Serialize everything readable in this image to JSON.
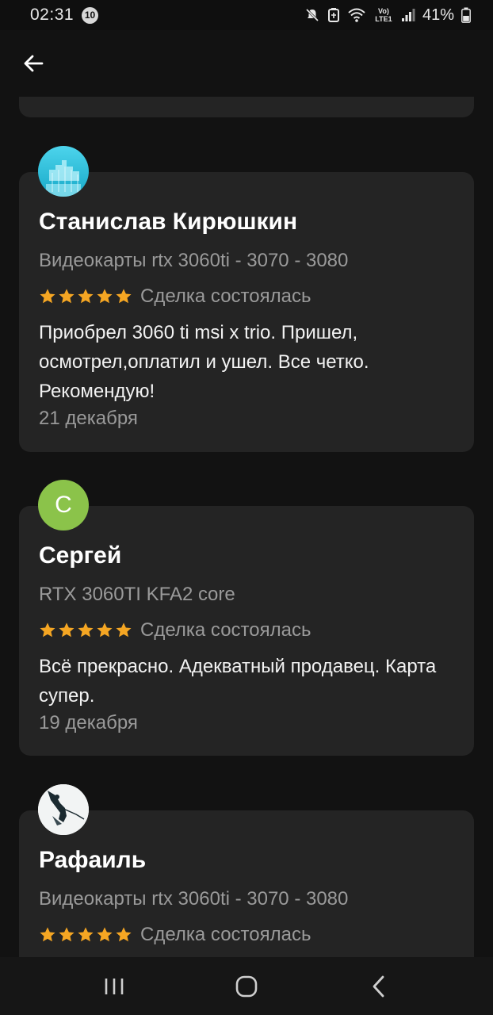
{
  "status_bar": {
    "time": "02:31",
    "notification_count": "10",
    "network_label": "Vo) LTE1",
    "battery_percent": "41%"
  },
  "app_bar": {
    "back_icon": "arrow-left-icon"
  },
  "reviews": [
    {
      "name": "Станислав Кирюшкин",
      "product": "Видеокарты rtx 3060ti - 3070 - 3080",
      "rating": 5,
      "deal_status": "Сделка состоялась",
      "text": "Приобрел 3060 ti msi x trio. Пришел, осмотрел,оплатил и ушел.  Все четко. Рекомендую!",
      "date": "21 декабря"
    },
    {
      "name": "Сергей",
      "avatar_letter": "С",
      "product": "RTX 3060TI KFA2 core",
      "rating": 5,
      "deal_status": "Сделка состоялась",
      "text": "Всё прекрасно. Адекватный продавец. Карта супер.",
      "date": "19 декабря"
    },
    {
      "name": "Рафаиль",
      "product": "Видеокарты rtx 3060ti - 3070 - 3080",
      "rating": 5,
      "deal_status": "Сделка состоялась"
    }
  ],
  "colors": {
    "star": "#f5a623",
    "card": "#242424",
    "background": "#121212",
    "avatar_green": "#8bc34a"
  }
}
